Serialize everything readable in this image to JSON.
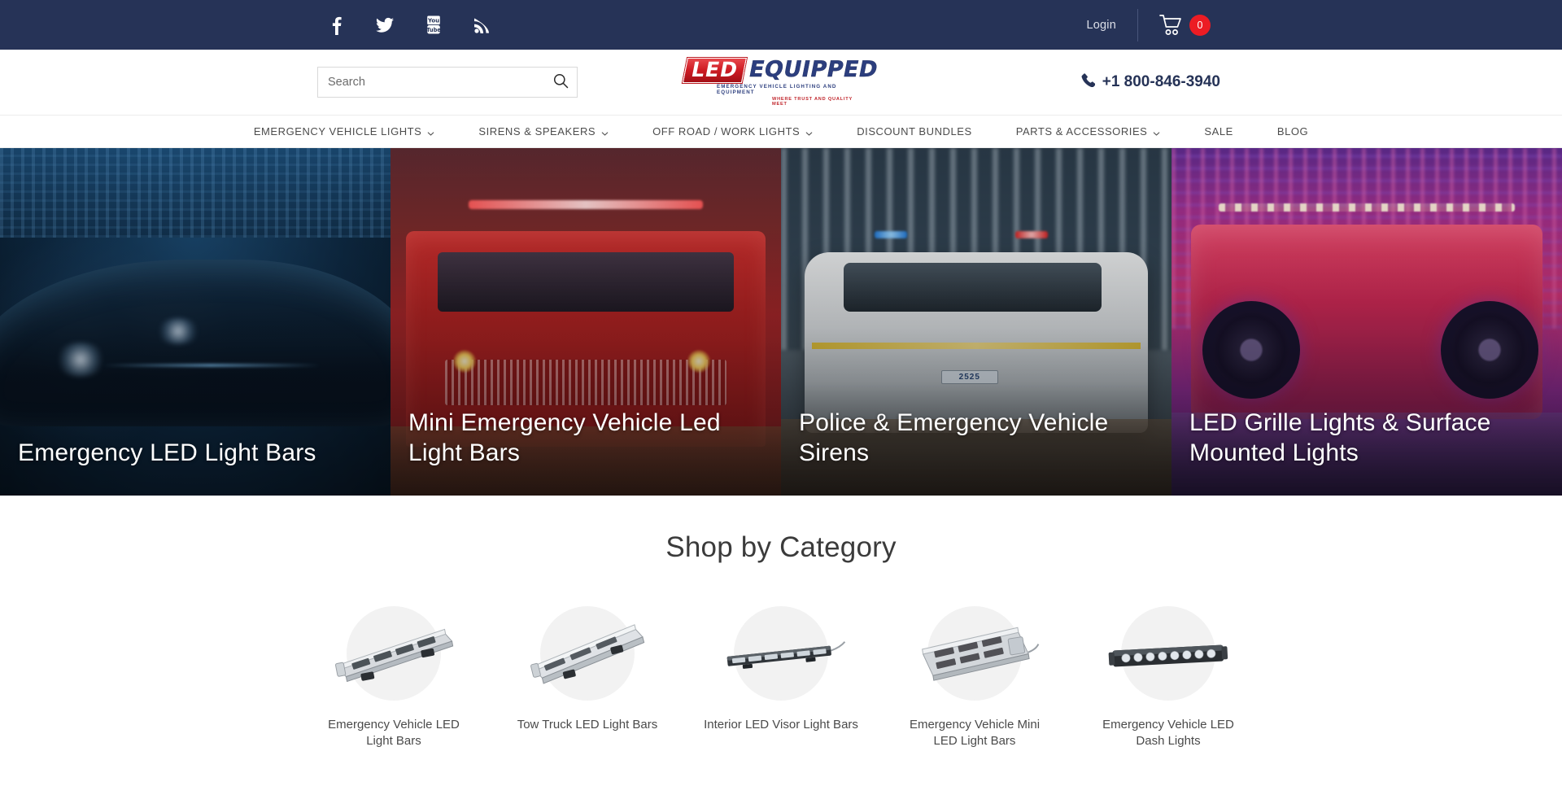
{
  "topbar": {
    "social": [
      {
        "name": "facebook-icon",
        "label": "Facebook"
      },
      {
        "name": "twitter-icon",
        "label": "Twitter"
      },
      {
        "name": "youtube-icon",
        "label": "YouTube"
      },
      {
        "name": "rss-icon",
        "label": "RSS Feed"
      }
    ],
    "login_label": "Login",
    "cart_icon": "cart-icon",
    "cart_count": "0",
    "background_color": "#263357",
    "badge_color": "#ec1c24"
  },
  "header": {
    "search": {
      "placeholder": "Search",
      "value": "",
      "icon": "search-icon"
    },
    "logo": {
      "mark": "LED",
      "word": "EQUIPPED",
      "tagline": "EMERGENCY VEHICLE LIGHTING AND EQUIPMENT",
      "subtagline": "WHERE TRUST AND QUALITY MEET",
      "red": "#cf1c24",
      "blue": "#2c3e7e"
    },
    "phone": {
      "icon": "phone-icon",
      "number": "+1 800-846-3940"
    }
  },
  "nav": {
    "items": [
      {
        "label": "EMERGENCY VEHICLE LIGHTS",
        "has_dropdown": true
      },
      {
        "label": "SIRENS & SPEAKERS",
        "has_dropdown": true
      },
      {
        "label": "OFF ROAD / WORK LIGHTS",
        "has_dropdown": true
      },
      {
        "label": "DISCOUNT BUNDLES",
        "has_dropdown": false
      },
      {
        "label": "PARTS & ACCESSORIES",
        "has_dropdown": true
      },
      {
        "label": "SALE",
        "has_dropdown": false
      },
      {
        "label": "BLOG",
        "has_dropdown": false
      }
    ]
  },
  "hero": {
    "tiles": [
      {
        "title": "Emergency LED Light Bars"
      },
      {
        "title": "Mini Emergency Vehicle Led Light Bars"
      },
      {
        "title": "Police & Emergency Vehicle Sirens"
      },
      {
        "title": "LED Grille Lights & Surface Mounted Lights"
      }
    ],
    "tile3_plate": "2525"
  },
  "categories": {
    "heading": "Shop by Category",
    "items": [
      {
        "label": "Emergency Vehicle LED Light Bars",
        "thumb": "light-bar-large"
      },
      {
        "label": "Tow Truck LED Light Bars",
        "thumb": "light-bar-tow"
      },
      {
        "label": "Interior LED Visor Light Bars",
        "thumb": "visor-light-bar"
      },
      {
        "label": "Emergency Vehicle Mini LED Light Bars",
        "thumb": "mini-light-bar"
      },
      {
        "label": "Emergency Vehicle LED Dash Lights",
        "thumb": "dash-light"
      }
    ]
  }
}
